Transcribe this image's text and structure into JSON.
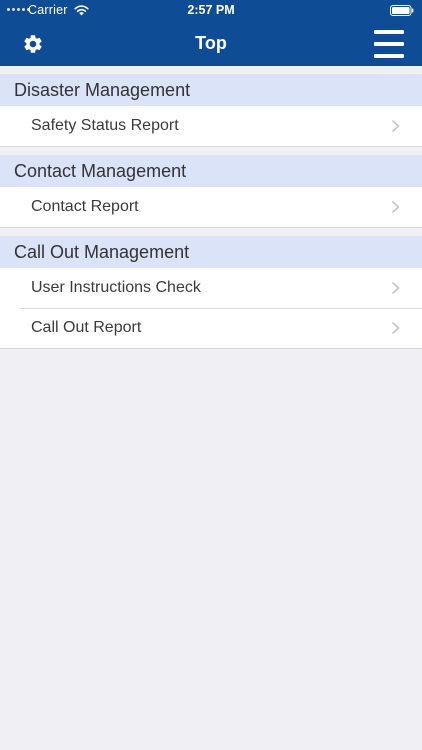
{
  "status_bar": {
    "carrier": "Carrier",
    "time": "2:57 PM",
    "icons": [
      "signal-dots-icon",
      "wifi-icon",
      "battery-icon"
    ]
  },
  "nav_bar": {
    "title": "Top",
    "left_icon": "gear-icon",
    "right_icon": "hamburger-menu-icon",
    "background_color": "#0f4c96"
  },
  "sections": [
    {
      "title": "Disaster Management",
      "items": [
        {
          "label": "Safety Status Report"
        }
      ]
    },
    {
      "title": "Contact Management",
      "items": [
        {
          "label": "Contact Report"
        }
      ]
    },
    {
      "title": "Call Out Management",
      "items": [
        {
          "label": "User Instructions Check"
        },
        {
          "label": "Call Out Report"
        }
      ]
    }
  ],
  "colors": {
    "section_header_bg": "#dbe3f8",
    "page_bg": "#efeff4"
  }
}
